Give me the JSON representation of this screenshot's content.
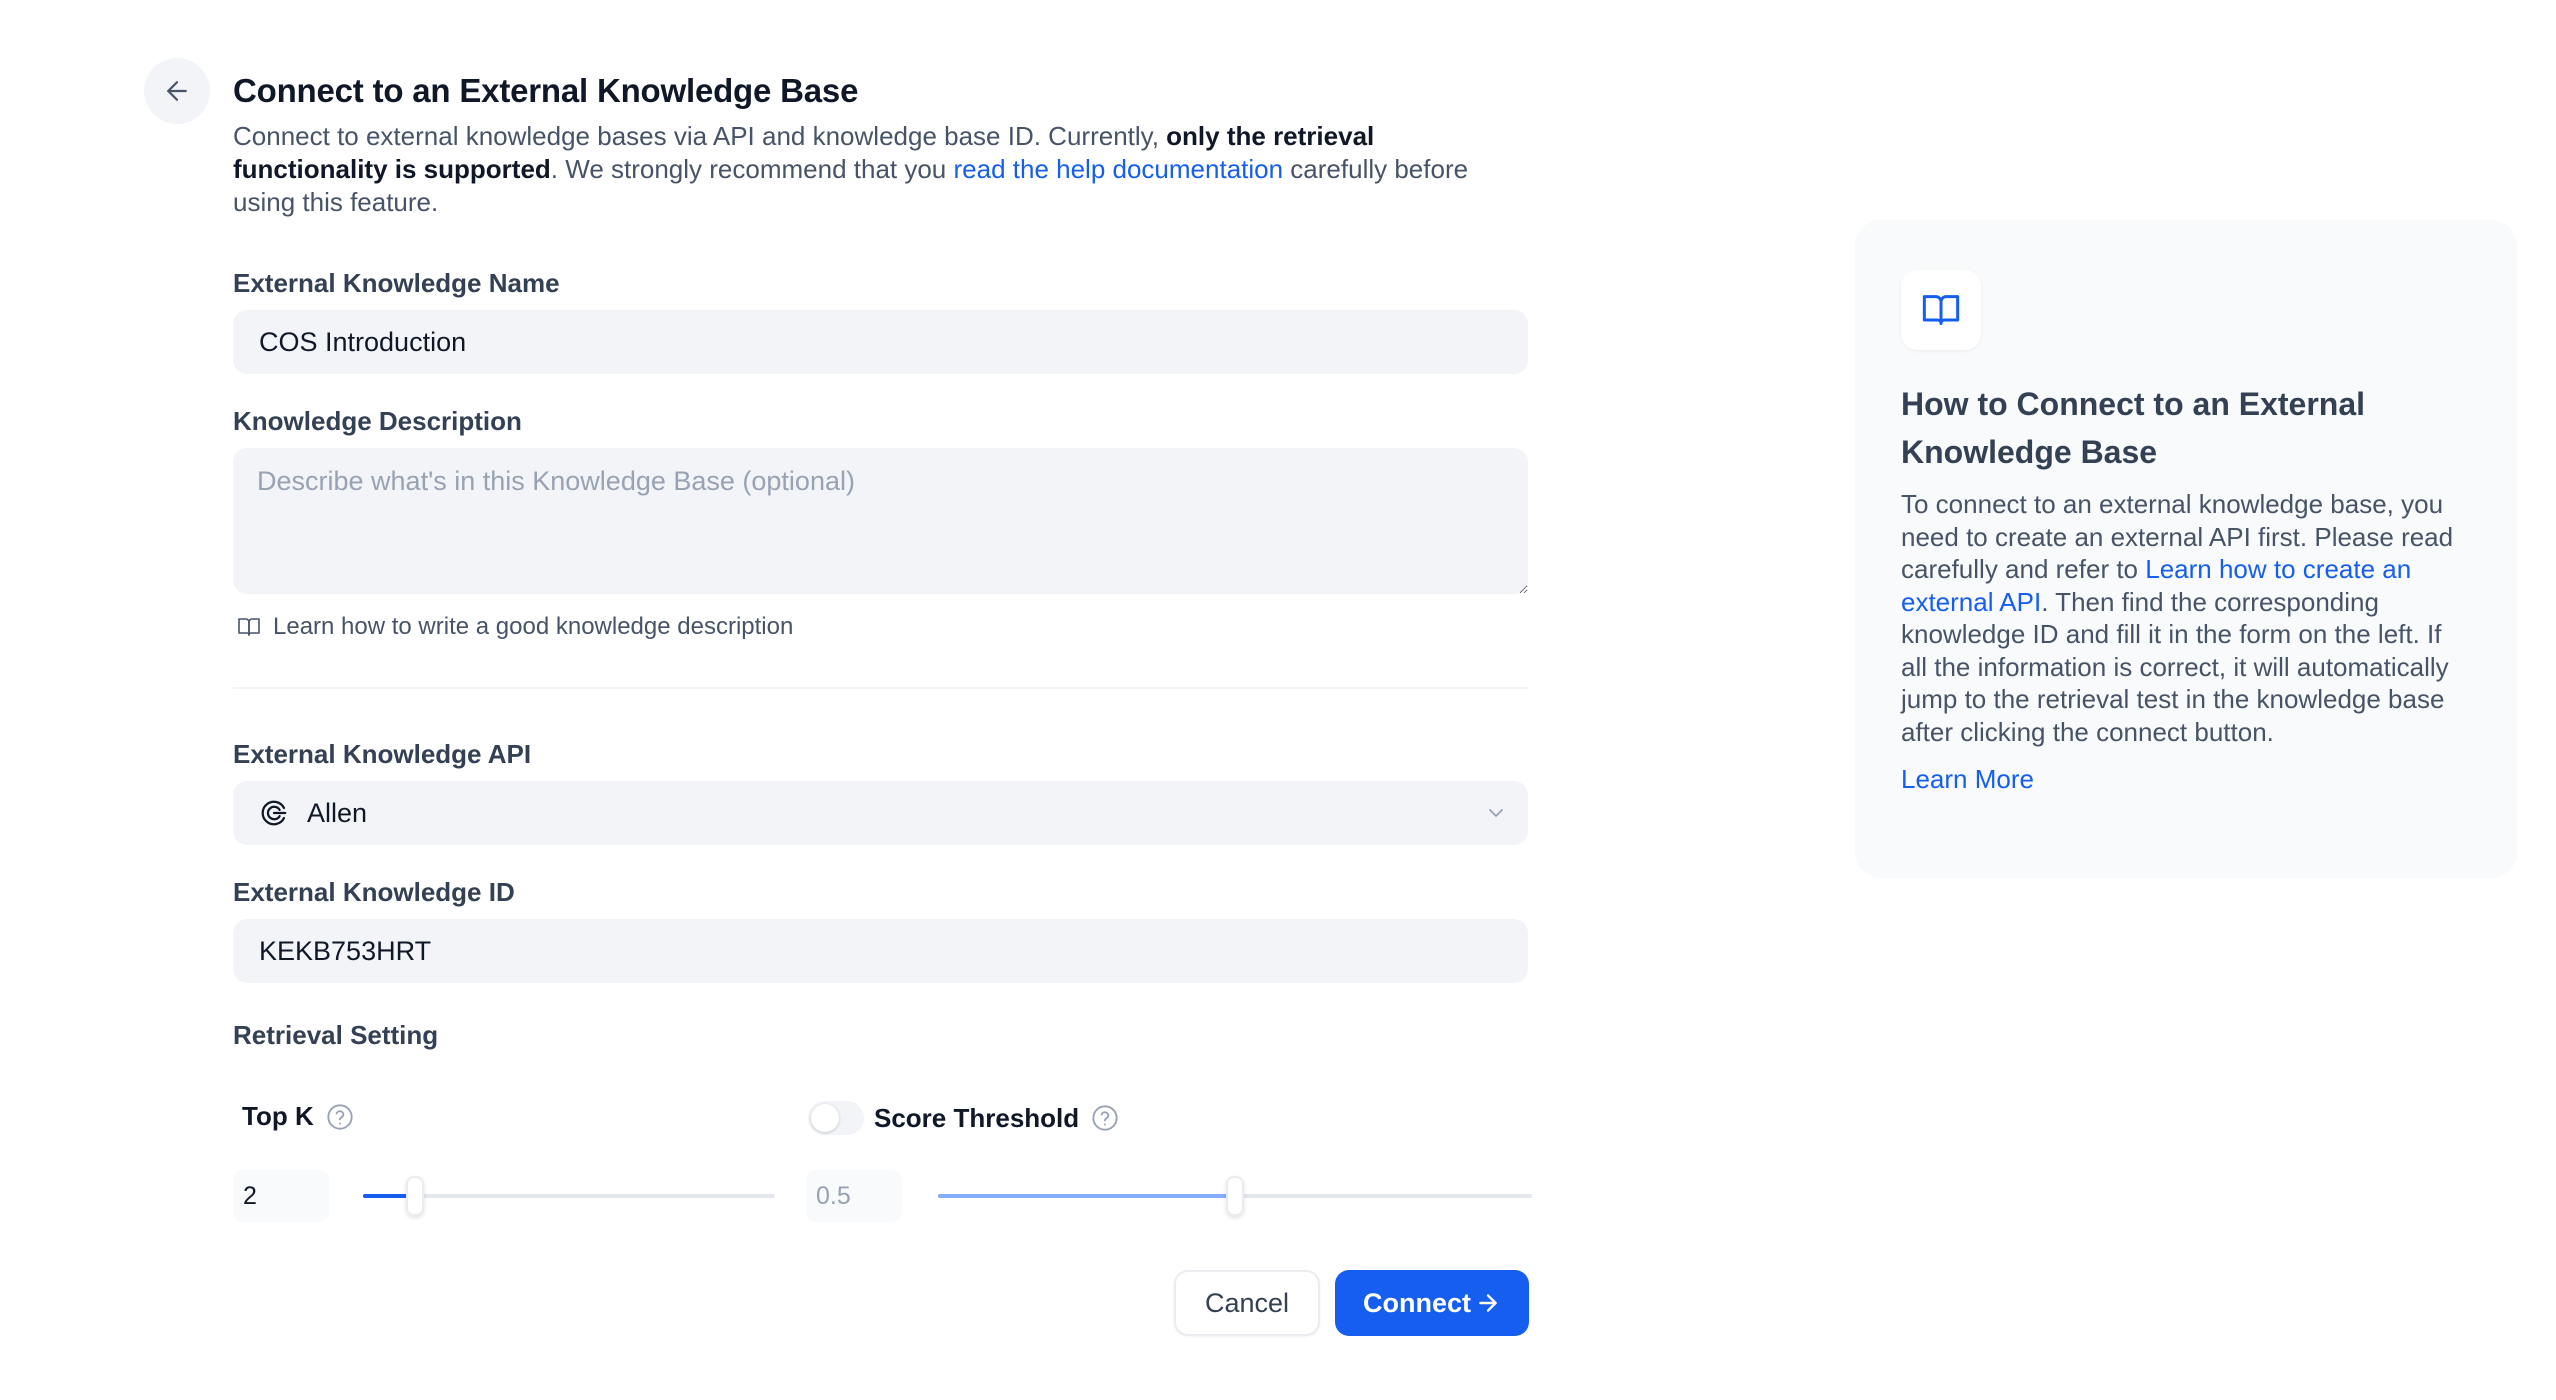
{
  "header": {
    "title": "Connect to an External Knowledge Base",
    "intro_1": "Connect to external knowledge bases via API and knowledge base ID. Currently, ",
    "intro_bold": "only the retrieval functionality is supported",
    "intro_2": ". We strongly recommend that you ",
    "intro_link": "read the help documentation",
    "intro_3": " carefully before using this feature."
  },
  "form": {
    "name_label": "External Knowledge Name",
    "name_value": "COS Introduction",
    "description_label": "Knowledge Description",
    "description_placeholder": "Describe what's in this Knowledge Base (optional)",
    "description_hint": "Learn how to write a good knowledge description",
    "api_label": "External Knowledge API",
    "api_value": "Allen",
    "id_label": "External Knowledge ID",
    "id_value": "KEKB753HRT"
  },
  "retrieval": {
    "title": "Retrieval Setting",
    "top_k_label": "Top K",
    "top_k_value": "2",
    "top_k_fraction": 0.125,
    "score_threshold_label": "Score Threshold",
    "score_threshold_value": "0.5",
    "score_threshold_fraction": 0.5,
    "score_threshold_enabled": false
  },
  "actions": {
    "cancel_label": "Cancel",
    "connect_label": "Connect"
  },
  "help": {
    "title": "How to Connect to an External Knowledge Base",
    "body_1": "To connect to an external knowledge base, you need to create an external API first. Please read carefully and refer to ",
    "body_link": "Learn how to create an external API",
    "body_2": ". Then find the corresponding knowledge ID and fill it in the form on the left. If all the information is correct, it will automatically jump to the retrieval test in the knowledge base after clicking the connect button.",
    "learn_more": "Learn More"
  },
  "colors": {
    "accent": "#155eef",
    "slider_active": "#155eef",
    "slider_disabled": "#84adff"
  },
  "icons": {
    "back": "arrow-left-icon",
    "hint": "book-open-icon",
    "api": "api-connection-icon",
    "chevron": "chevron-down-icon",
    "question": "question-circle-icon",
    "connect": "arrow-right-icon",
    "help": "book-open-icon"
  }
}
